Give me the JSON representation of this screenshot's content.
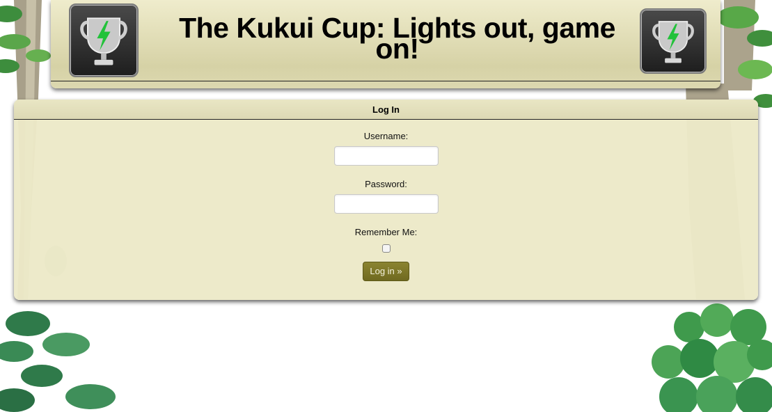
{
  "header": {
    "title": "The Kukui Cup: Lights out, game on!",
    "left_icon": "trophy-lightning-icon",
    "right_icon": "trophy-lightning-icon"
  },
  "login": {
    "heading": "Log In",
    "username_label": "Username:",
    "username_value": "",
    "password_label": "Password:",
    "password_value": "",
    "remember_label": "Remember Me:",
    "remember_checked": false,
    "submit_label": "Log in »"
  },
  "colors": {
    "panel_bg": "#ece9c8",
    "button_bg": "#7d7628",
    "lightning": "#22c23a"
  }
}
